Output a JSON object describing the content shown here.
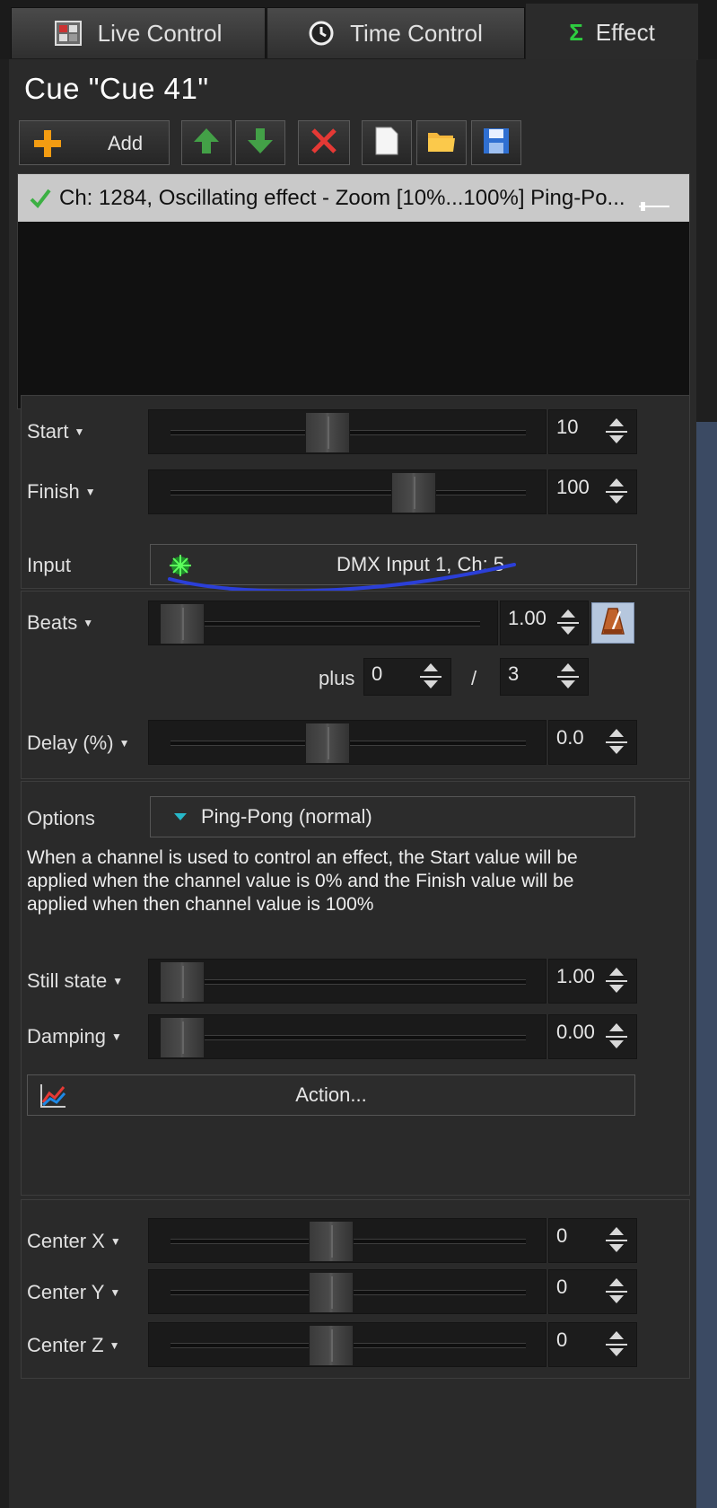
{
  "tabs": [
    {
      "label": "Live Control",
      "icon": "live-control-icon"
    },
    {
      "label": "Time Control",
      "icon": "clock-icon"
    },
    {
      "label": "Effect",
      "icon": "sigma-icon"
    }
  ],
  "cue": {
    "title": "Cue \"Cue 41\""
  },
  "toolbar": {
    "add_label": "Add"
  },
  "effects": [
    {
      "text": "Ch: 1284, Oscillating effect - Zoom [10%...100%] Ping-Po..."
    }
  ],
  "params": {
    "start": {
      "label": "Start",
      "value": "10",
      "level": 0.44
    },
    "finish": {
      "label": "Finish",
      "value": "100",
      "level": 0.7
    },
    "input": {
      "label": "Input",
      "value": "DMX Input 1, Ch: 5"
    },
    "beats": {
      "label": "Beats",
      "value": "1.00",
      "level": 0.0
    },
    "plus_label": "plus",
    "plus_value": "0",
    "divider": "/",
    "divisor": "3",
    "delay": {
      "label": "Delay (%)",
      "value": "0.0",
      "level": 0.44
    }
  },
  "options": {
    "label": "Options",
    "selected": "Ping-Pong (normal)",
    "description": "When a channel is used to control an effect, the Start value will be applied when the channel value is 0% and the Finish value will be applied when then channel value is 100%"
  },
  "still_state": {
    "label": "Still state",
    "value": "1.00",
    "level": 0.0
  },
  "damping": {
    "label": "Damping",
    "value": "0.00",
    "level": 0.0
  },
  "action": {
    "label": "Action..."
  },
  "center": {
    "x": {
      "label": "Center X",
      "value": "0",
      "level": 0.45
    },
    "y": {
      "label": "Center Y",
      "value": "0",
      "level": 0.45
    },
    "z": {
      "label": "Center Z",
      "value": "0",
      "level": 0.45
    }
  },
  "colors": {
    "accent_blue": "#2b3fd8",
    "selection": "#c9c9c9",
    "panel": "#2a2a2a"
  }
}
